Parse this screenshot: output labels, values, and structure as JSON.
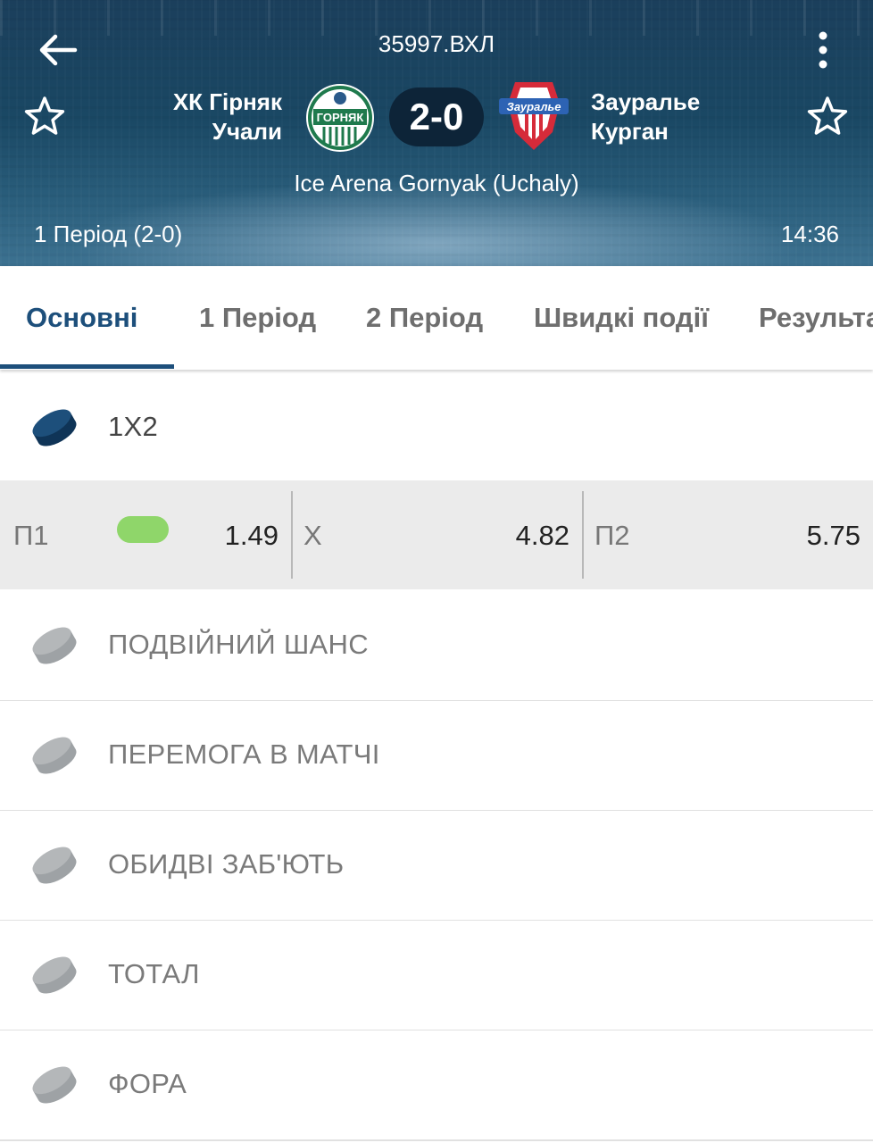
{
  "header": {
    "league": "35997.ВХЛ",
    "home_team": [
      "ХК Гірняк",
      "Учали"
    ],
    "away_team": [
      "Зауралье",
      "Курган"
    ],
    "home_logo_text": "ГОРНЯК",
    "away_logo_text": "Зауралье",
    "score": "2-0",
    "arena": "Ice Arena Gornyak (Uchaly)",
    "period": "1 Період (2-0)",
    "clock": "14:36"
  },
  "tabs": [
    {
      "label": "Основні",
      "active": true
    },
    {
      "label": "1 Період",
      "active": false
    },
    {
      "label": "2 Період",
      "active": false
    },
    {
      "label": "Швидкі події",
      "active": false
    },
    {
      "label": "Результа",
      "active": false
    }
  ],
  "markets": [
    {
      "label": "1X2",
      "expanded": true
    },
    {
      "label": "ПОДВІЙНИЙ ШАНС",
      "expanded": false
    },
    {
      "label": "ПЕРЕМОГА В МАТЧІ",
      "expanded": false
    },
    {
      "label": "ОБИДВІ ЗАБ'ЮТЬ",
      "expanded": false
    },
    {
      "label": "ТОТАЛ",
      "expanded": false
    },
    {
      "label": "ФОРА",
      "expanded": false
    }
  ],
  "odds": [
    {
      "name": "П1",
      "value": "1.49"
    },
    {
      "name": "X",
      "value": "4.82"
    },
    {
      "name": "П2",
      "value": "5.75"
    }
  ],
  "colors": {
    "accent": "#1d4f7b",
    "puck_active": "#1d4f7b",
    "puck_inactive": "#b4b7b9",
    "indicator": "#8fd66a"
  },
  "icons": {
    "back": "arrow-left-icon",
    "menu": "kebab-menu-icon",
    "favorite": "star-outline-icon",
    "market": "hockey-puck-icon"
  }
}
